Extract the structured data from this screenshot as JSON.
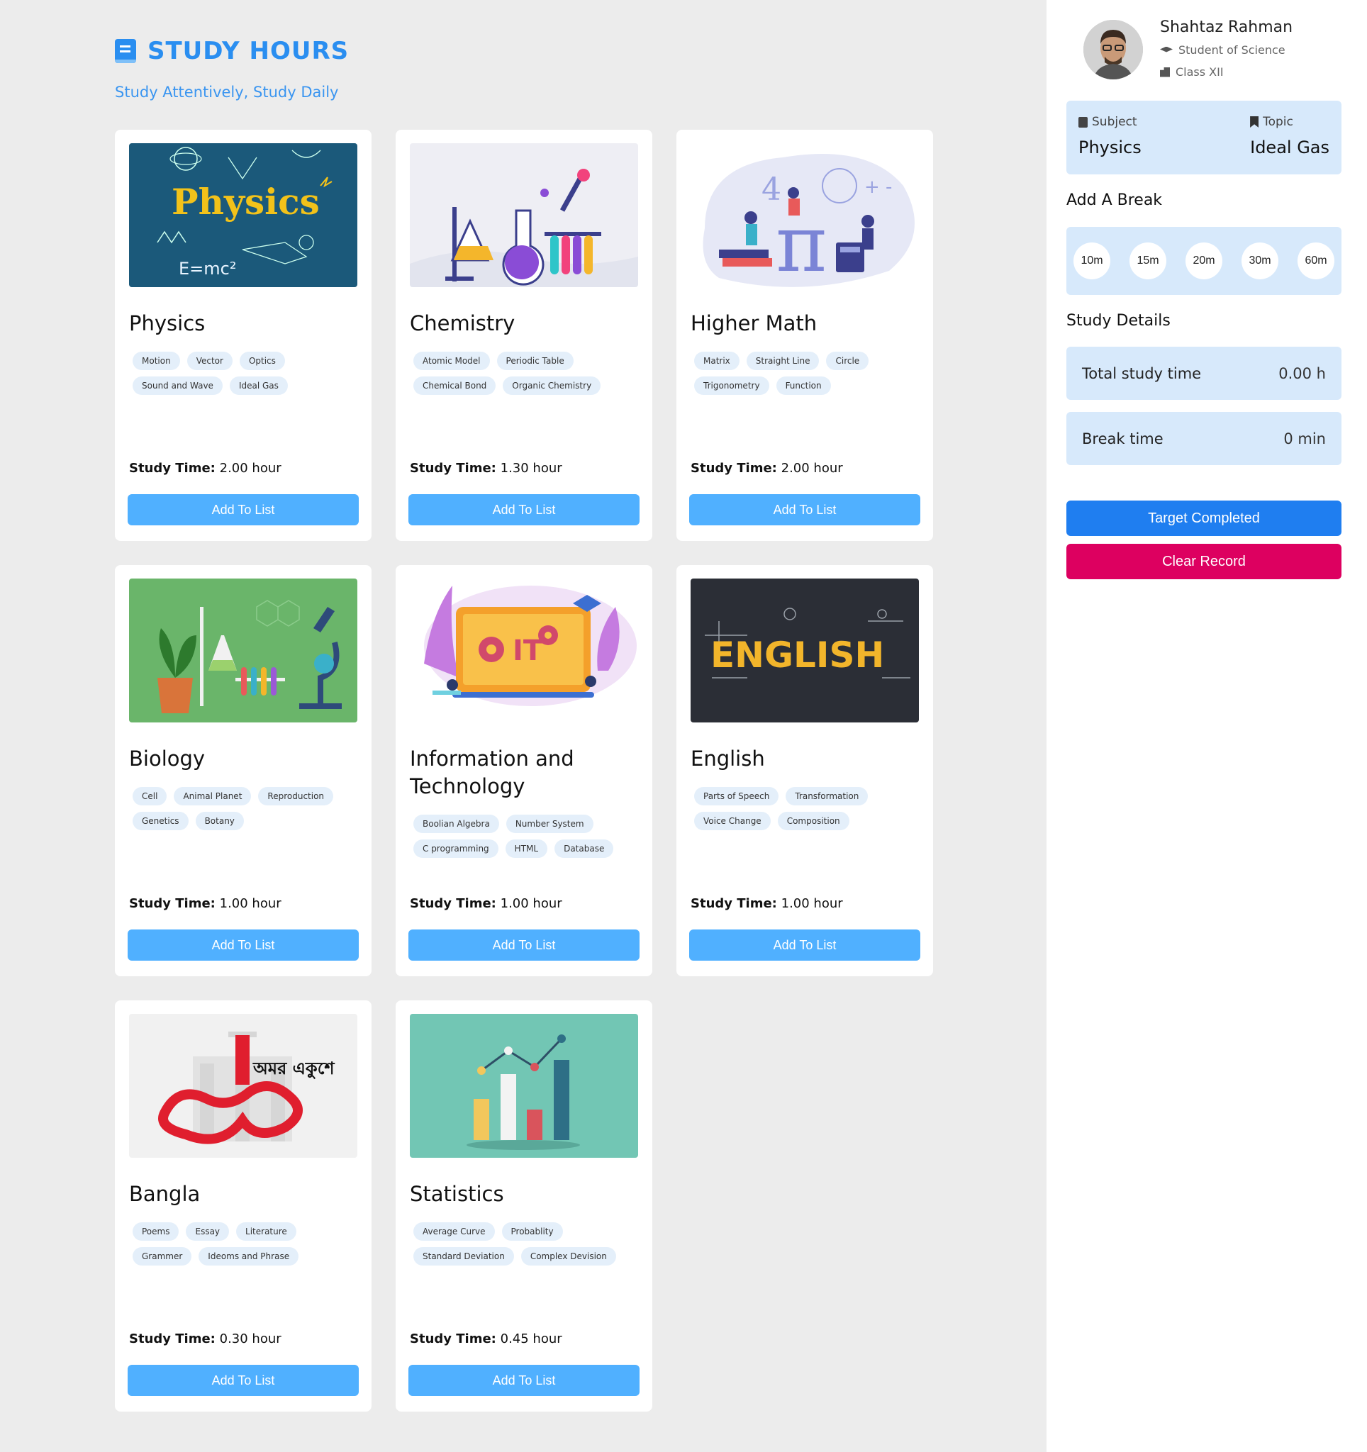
{
  "header": {
    "title": "STUDY HOURS",
    "subtitle": "Study Attentively, Study Daily"
  },
  "cards": [
    {
      "title": "Physics",
      "image_text": "Physics",
      "tags": [
        "Motion",
        "Vector",
        "Optics",
        "Sound and Wave",
        "Ideal Gas"
      ],
      "time_label": "Study Time:",
      "time_value": "2.00 hour",
      "button": "Add To List"
    },
    {
      "title": "Chemistry",
      "tags": [
        "Atomic Model",
        "Periodic Table",
        "Chemical Bond",
        "Organic Chemistry"
      ],
      "time_label": "Study Time:",
      "time_value": "1.30 hour",
      "button": "Add To List"
    },
    {
      "title": "Higher Math",
      "tags": [
        "Matrix",
        "Straight Line",
        "Circle",
        "Trigonometry",
        "Function"
      ],
      "time_label": "Study Time:",
      "time_value": "2.00 hour",
      "button": "Add To List"
    },
    {
      "title": "Biology",
      "tags": [
        "Cell",
        "Animal Planet",
        "Reproduction",
        "Genetics",
        "Botany"
      ],
      "time_label": "Study Time:",
      "time_value": "1.00 hour",
      "button": "Add To List"
    },
    {
      "title": "Information and Technology",
      "image_text": "IT",
      "tags": [
        "Boolian Algebra",
        "Number System",
        "C programming",
        "HTML",
        "Database"
      ],
      "time_label": "Study Time:",
      "time_value": "1.00 hour",
      "button": "Add To List"
    },
    {
      "title": "English",
      "image_text": "ENGLISH",
      "tags": [
        "Parts of Speech",
        "Transformation",
        "Voice Change",
        "Composition"
      ],
      "time_label": "Study Time:",
      "time_value": "1.00 hour",
      "button": "Add To List"
    },
    {
      "title": "Bangla",
      "image_text": "অমর একুশে",
      "tags": [
        "Poems",
        "Essay",
        "Literature",
        "Grammer",
        "Ideoms and Phrase"
      ],
      "time_label": "Study Time:",
      "time_value": "0.30 hour",
      "button": "Add To List"
    },
    {
      "title": "Statistics",
      "tags": [
        "Average Curve",
        "Probablity",
        "Standard Deviation",
        "Complex Devision"
      ],
      "time_label": "Study Time:",
      "time_value": "0.45 hour",
      "button": "Add To List"
    }
  ],
  "profile": {
    "name": "Shahtaz Rahman",
    "role": "Student of Science",
    "class": "Class XII"
  },
  "current": {
    "subject_label": "Subject",
    "subject_value": "Physics",
    "topic_label": "Topic",
    "topic_value": "Ideal Gas"
  },
  "break_section": {
    "title": "Add A Break",
    "options": [
      "10m",
      "15m",
      "20m",
      "30m",
      "60m"
    ]
  },
  "details": {
    "title": "Study Details",
    "total_label": "Total study time",
    "total_value": "0.00 h",
    "break_label": "Break time",
    "break_value": "0 min"
  },
  "actions": {
    "target": "Target Completed",
    "clear": "Clear Record"
  },
  "colors": {
    "accent": "#2a8ef0",
    "button": "#50b0ff",
    "panel": "#d7e9fb",
    "target": "#1f7ef0",
    "clear": "#dd0060"
  }
}
